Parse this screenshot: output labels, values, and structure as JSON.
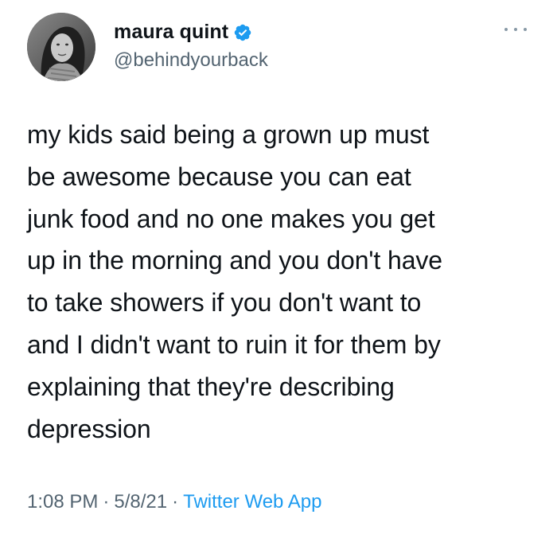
{
  "user": {
    "display_name": "maura quint",
    "handle": "@behindyourback",
    "verified": true,
    "avatar": "profile-photo"
  },
  "tweet": {
    "text": "my kids said being a grown up must\nbe awesome because you can eat\njunk food and no one makes you get\nup in the morning and you don't have\nto take showers if you don't want to\nand I didn't want to ruin it for them by\nexplaining that they're describing\ndepression",
    "time": "1:08 PM",
    "separator": "·",
    "date": "5/8/21",
    "source": "Twitter Web App"
  },
  "colors": {
    "verified_badge": "#1d9bf0",
    "secondary_text": "#536471",
    "link": "#1d9bf0",
    "primary_text": "#0f1419"
  },
  "icons": {
    "more": "more-horizontal-icon",
    "verified": "verified-badge-icon"
  }
}
